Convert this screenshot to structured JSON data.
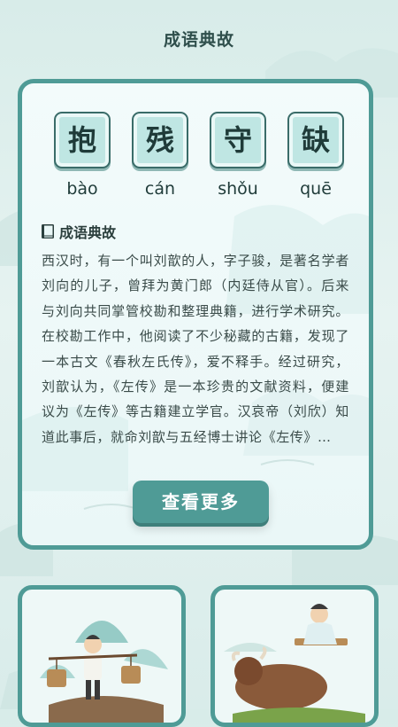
{
  "header": {
    "title": "成语典故"
  },
  "idiom": {
    "characters": [
      "抱",
      "残",
      "守",
      "缺"
    ],
    "pinyin": [
      "bào",
      "cán",
      "shǒu",
      "quē"
    ]
  },
  "story": {
    "section_title": "成语典故",
    "text": "西汉时，有一个叫刘歆的人，字子骏，是著名学者刘向的儿子，曾拜为黄门郎（内廷侍从官）。后来与刘向共同掌管校勘和整理典籍，进行学术研究。在校勘工作中，他阅读了不少秘藏的古籍，发现了一本古文《春秋左氏传》，爱不释手。经过研究，刘歆认为，《左传》是一本珍贵的文献资料，便建议为《左传》等古籍建立学官。汉哀帝（刘欣）知道此事后，就命刘歆与五经博士讲论《左传》…"
  },
  "buttons": {
    "more_label": "查看更多"
  },
  "icons": {
    "section": "book-icon",
    "thumb_left": "porter-illustration",
    "thumb_right": "scholar-ox-illustration"
  },
  "colors": {
    "accent": "#4f9b96",
    "tile_fill": "#bfe6e3",
    "background": "#dcefec"
  }
}
